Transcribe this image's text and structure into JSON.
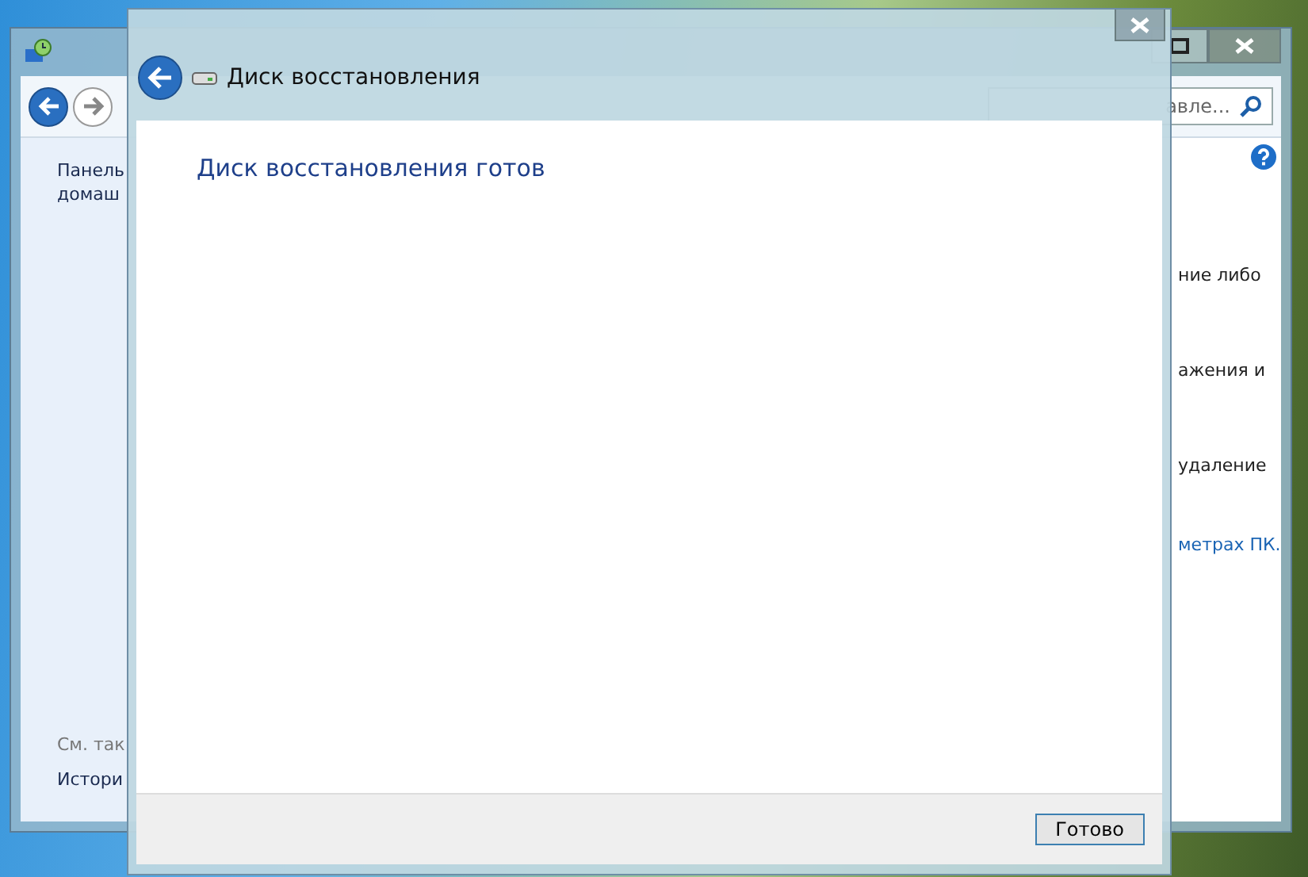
{
  "back_window": {
    "search": {
      "placeholder": "авле..."
    },
    "sidebar": {
      "lines": [
        "Панель",
        "домаш"
      ],
      "see_also_heading": "См. так",
      "see_also_items": [
        "Истори"
      ]
    },
    "content_lines": [
      {
        "kind": "text",
        "text": "ние либо"
      },
      {
        "kind": "text",
        "text": "ажения и"
      },
      {
        "kind": "text",
        "text": "удаление"
      },
      {
        "kind": "link",
        "text": "метрах ПК."
      }
    ]
  },
  "dialog": {
    "title": "Диск восстановления",
    "heading": "Диск восстановления готов",
    "buttons": [
      {
        "label": "Готово",
        "default": true
      }
    ]
  }
}
